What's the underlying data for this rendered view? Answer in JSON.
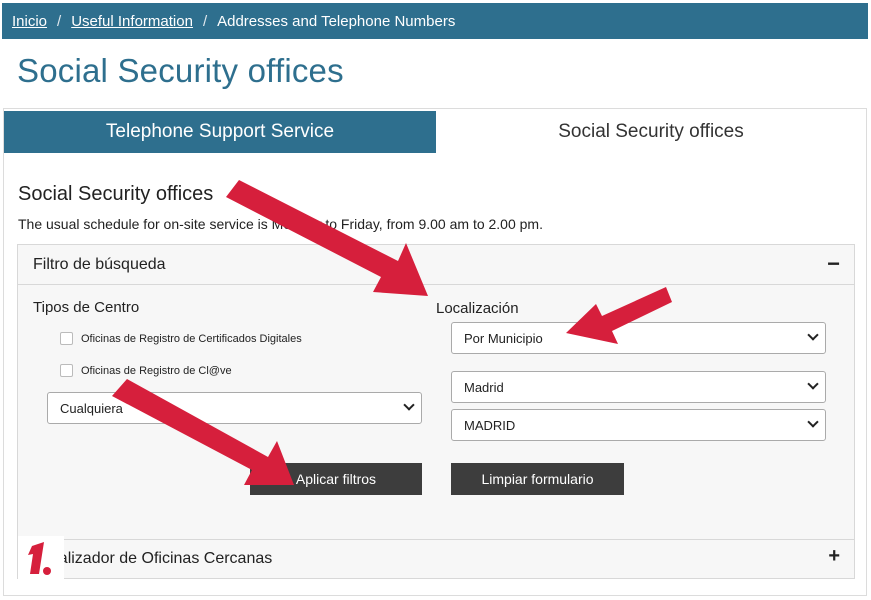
{
  "breadcrumb": {
    "home": "Inicio",
    "section": "Useful Information",
    "current": "Addresses and Telephone Numbers",
    "separator": "/"
  },
  "page_title": "Social Security offices",
  "tabs": [
    {
      "label": "Telephone Support Service",
      "active": true
    },
    {
      "label": "Social Security offices",
      "active": false
    }
  ],
  "section": {
    "title": "Social Security offices",
    "schedule_text": "The usual schedule for on-site service is Monday to Friday, from 9.00 am to 2.00 pm."
  },
  "filter": {
    "header": "Filtro de búsqueda",
    "toggle": "−",
    "tipos_label": "Tipos de Centro",
    "checkboxes": [
      {
        "label": "Oficinas de Registro de Certificados Digitales",
        "checked": false
      },
      {
        "label": "Oficinas de Registro de Cl@ve",
        "checked": false
      }
    ],
    "center_select": "Cualquiera",
    "localizacion_label": "Localización",
    "location_mode_select": "Por Municipio",
    "province_select": "Madrid",
    "municipality_select": "MADRID",
    "apply_button": "Aplicar filtros",
    "clear_button": "Limpiar formulario"
  },
  "nearby": {
    "label": "Localizador de Oficinas Cercanas",
    "toggle": "+"
  },
  "logo": {
    "text": "1."
  },
  "colors": {
    "brand_blue": "#2e6f8e",
    "button_dark": "#3d3d3d",
    "arrow_red": "#d61f3c",
    "panel_bg": "#f7f7f7"
  }
}
